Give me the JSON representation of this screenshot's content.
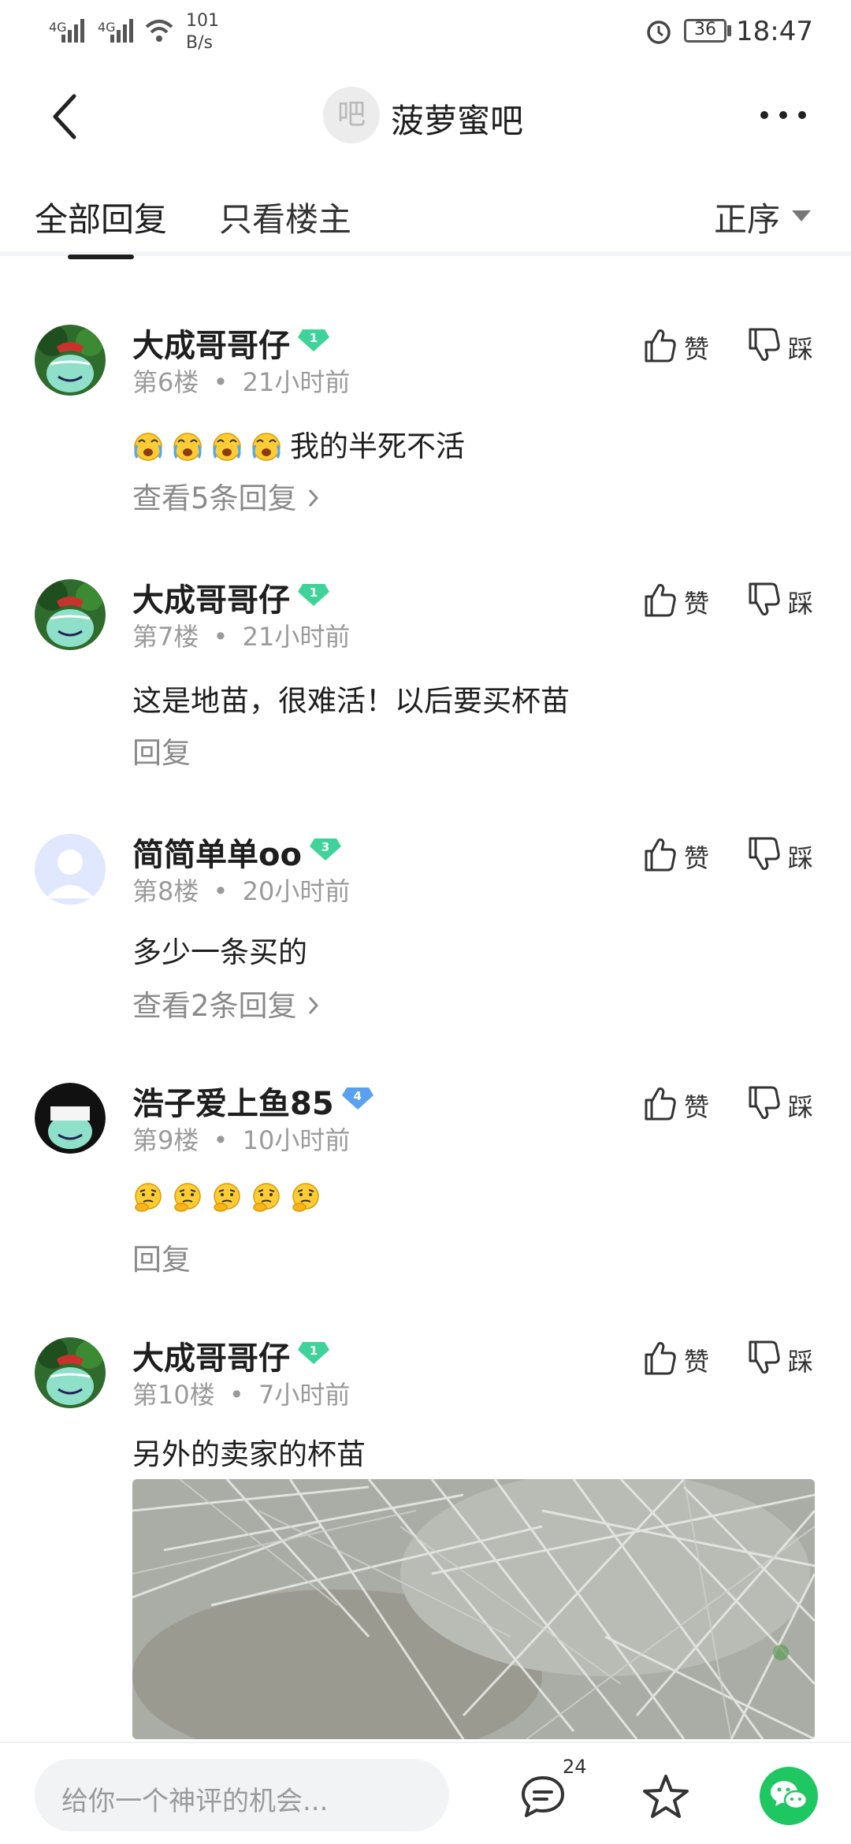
{
  "status_bar": {
    "network1": "4G",
    "network2": "4G",
    "speed_value": "101",
    "speed_unit": "B/s",
    "battery": "36",
    "time": "18:47"
  },
  "nav": {
    "back_icon": "chevron-left-icon",
    "forum_badge": "吧",
    "forum_name": "菠萝蜜吧",
    "more_icon": "more-dots-icon"
  },
  "tabs": {
    "all_replies": "全部回复",
    "op_only": "只看楼主",
    "sort": "正序"
  },
  "actions": {
    "like": "赞",
    "dislike": "踩"
  },
  "comments": [
    {
      "user": "大成哥哥仔",
      "level": "1",
      "floor": "第6楼",
      "time": "21小时前",
      "text": "我的半死不活",
      "emoji_count": 4,
      "reply": "查看5条回复"
    },
    {
      "user": "大成哥哥仔",
      "level": "1",
      "floor": "第7楼",
      "time": "21小时前",
      "text": "这是地苗，很难活！以后要买杯苗",
      "reply": "回复"
    },
    {
      "user": "简简单单oo",
      "level": "3",
      "floor": "第8楼",
      "time": "20小时前",
      "text": "多少一条买的",
      "reply": "查看2条回复"
    },
    {
      "user": "浩子爱上鱼85",
      "level": "4",
      "floor": "第9楼",
      "time": "10小时前",
      "emoji_count": 5,
      "reply": "回复"
    },
    {
      "user": "大成哥哥仔",
      "level": "1",
      "floor": "第10楼",
      "time": "7小时前",
      "text": "另外的卖家的杯苗"
    }
  ],
  "meta_separator": "•",
  "bottom_bar": {
    "input_placeholder": "给你一个神评的机会...",
    "comment_count": "24"
  },
  "colors": {
    "level_green": "#3fd39a",
    "level_blue": "#5aa0f0",
    "wechat_green": "#1ec761"
  }
}
